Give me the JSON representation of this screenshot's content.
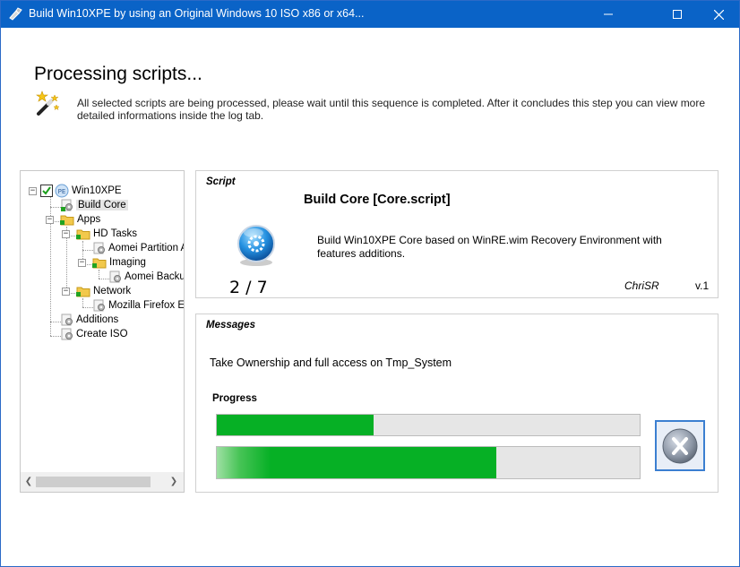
{
  "window": {
    "title": "Build Win10XPE by using an Original Windows 10 ISO x86 or x64...",
    "controls": [
      "minimize-icon",
      "maximize-icon",
      "close-icon"
    ]
  },
  "header": {
    "heading": "Processing scripts...",
    "description": "All selected scripts are being processed, please wait until this sequence is completed. After it concludes this step you can view more detailed informations inside the log tab.",
    "icon": "magic-wand-icon"
  },
  "tree": {
    "items": [
      {
        "label": "Win10XPE",
        "icon": "project-icon",
        "checked": true,
        "expander": "minus"
      },
      {
        "label": "Build Core",
        "icon": "script-gear-icon",
        "selected": true
      },
      {
        "label": "Apps",
        "icon": "folder-icon",
        "expander": "minus"
      },
      {
        "label": "HD Tasks",
        "icon": "folder-icon",
        "expander": "minus"
      },
      {
        "label": "Aomei Partition A",
        "icon": "script-gear-icon"
      },
      {
        "label": "Imaging",
        "icon": "folder-icon",
        "expander": "minus"
      },
      {
        "label": "Aomei Backu",
        "icon": "script-gear-icon"
      },
      {
        "label": "Network",
        "icon": "folder-icon",
        "expander": "minus"
      },
      {
        "label": "Mozilla Firefox ES",
        "icon": "script-gear-icon"
      },
      {
        "label": "Additions",
        "icon": "script-gear-icon"
      },
      {
        "label": "Create ISO",
        "icon": "script-gear-icon"
      }
    ]
  },
  "script": {
    "group_title": "Script",
    "name": "Build Core [Core.script]",
    "description": "Build Win10XPE Core based on WinRE.wim Recovery Environment with features additions.",
    "counter": "2 / 7",
    "author": "ChriSR",
    "version": "v.1"
  },
  "messages": {
    "group_title": "Messages",
    "text": "Take Ownership and full access on Tmp_System",
    "progress_label": "Progress",
    "progress_script": 0.37,
    "progress_total": 0.66
  },
  "colors": {
    "titlebar": "#0a63c7",
    "progress_green": "#06b025"
  }
}
